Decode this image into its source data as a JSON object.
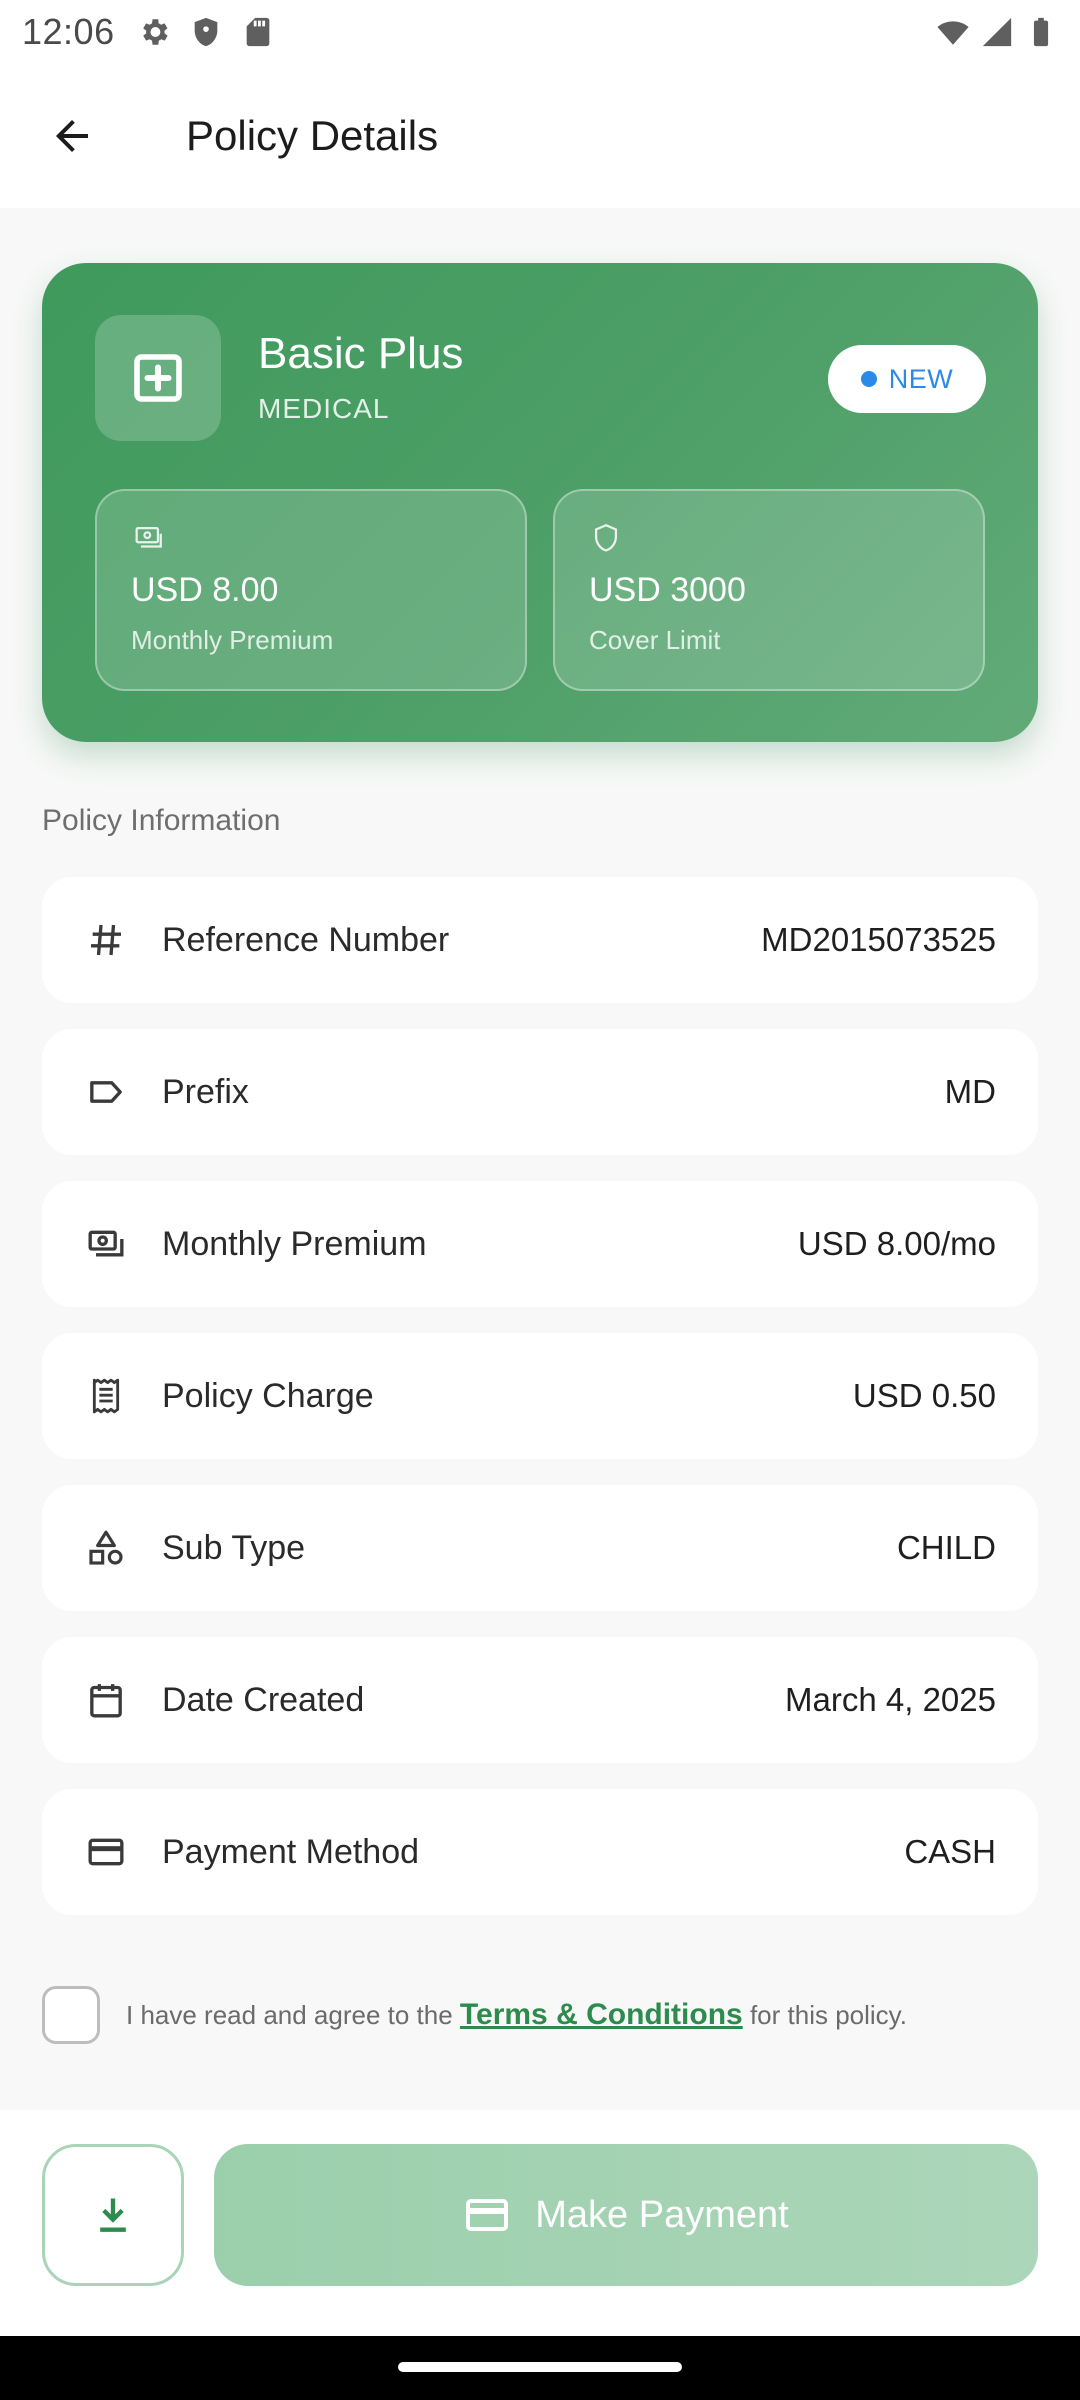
{
  "status_bar": {
    "time": "12:06",
    "left_icons": [
      "settings-icon",
      "shield-icon",
      "sd-card-icon"
    ],
    "right_icons": [
      "wifi-icon",
      "signal-icon",
      "battery-icon"
    ]
  },
  "app_bar": {
    "title": "Policy Details",
    "back_icon": "arrow-back-icon"
  },
  "hero": {
    "title": "Basic Plus",
    "subtitle": "MEDICAL",
    "badge": "NEW",
    "colors": {
      "card": "#4a9d63",
      "badge_text": "#2b8ae8"
    },
    "stats": [
      {
        "value": "USD 8.00",
        "label": "Monthly Premium",
        "icon": "cash-icon"
      },
      {
        "value": "USD 3000",
        "label": "Cover Limit",
        "icon": "shield-icon"
      }
    ]
  },
  "section_title": "Policy Information",
  "rows": [
    {
      "label": "Reference Number",
      "value": "MD2015073525",
      "icon": "hash-icon"
    },
    {
      "label": "Prefix",
      "value": "MD",
      "icon": "label-icon"
    },
    {
      "label": "Monthly Premium",
      "value": "USD 8.00/mo",
      "icon": "cash-icon"
    },
    {
      "label": "Policy Charge",
      "value": "USD 0.50",
      "icon": "receipt-icon"
    },
    {
      "label": "Sub Type",
      "value": "CHILD",
      "icon": "category-icon"
    },
    {
      "label": "Date Created",
      "value": "March 4, 2025",
      "icon": "calendar-icon"
    },
    {
      "label": "Payment Method",
      "value": "CASH",
      "icon": "credit-card-icon"
    }
  ],
  "terms": {
    "prefix": "I have read and agree to the ",
    "link": "Terms & Conditions",
    "suffix": " for this policy.",
    "checked": false
  },
  "actions": {
    "download_icon": "download-icon",
    "pay_label": "Make Payment",
    "pay_icon": "credit-card-icon",
    "accent": "#2e8b4e"
  }
}
